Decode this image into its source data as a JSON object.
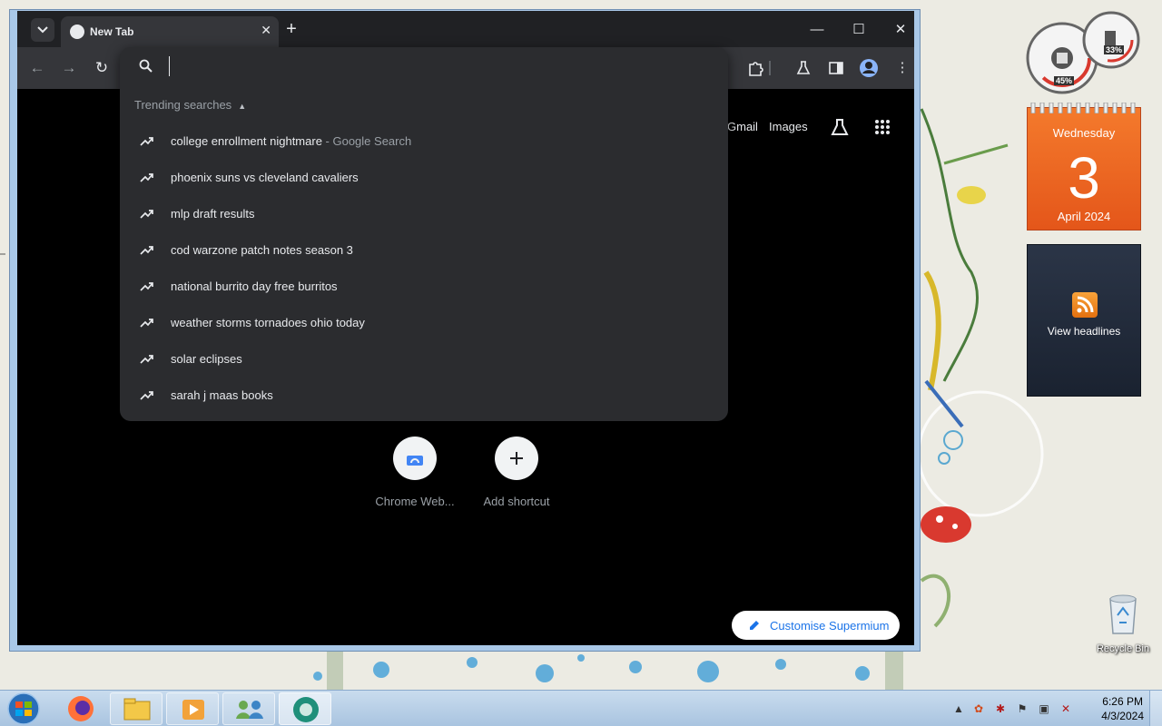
{
  "browser": {
    "tab": {
      "title": "New Tab",
      "close_icon": "close-icon"
    },
    "new_tab_icon": "plus-icon",
    "window_controls": [
      "minimize-icon",
      "maximize-icon",
      "close-icon"
    ],
    "toolbar_icons": [
      "back-icon",
      "forward-icon",
      "reload-icon",
      "extensions-icon",
      "labs-icon",
      "side-panel-icon",
      "profile-icon",
      "menu-icon"
    ]
  },
  "omnibox": {
    "input_value": "",
    "trending_header": "Trending searches",
    "suggestions": [
      {
        "text": "college enrollment nightmare",
        "sub": " - Google Search"
      },
      {
        "text": "phoenix suns vs cleveland cavaliers",
        "sub": ""
      },
      {
        "text": "mlp draft results",
        "sub": ""
      },
      {
        "text": "cod warzone patch notes season 3",
        "sub": ""
      },
      {
        "text": "national burrito day free burritos",
        "sub": ""
      },
      {
        "text": "weather storms tornadoes ohio today",
        "sub": ""
      },
      {
        "text": "solar eclipses",
        "sub": ""
      },
      {
        "text": "sarah j maas books",
        "sub": ""
      }
    ]
  },
  "ntp": {
    "header_links": {
      "gmail": "Gmail",
      "images": "Images"
    },
    "shortcuts": [
      {
        "label": "Chrome Web..."
      },
      {
        "label": "Add shortcut"
      }
    ],
    "customise_label": "Customise Supermium"
  },
  "gadgets": {
    "cpu_gauge": {
      "cpu_percent": "45%",
      "memory_percent": "33%"
    },
    "calendar": {
      "weekday": "Wednesday",
      "day": "3",
      "month_year": "April 2024"
    },
    "feed": {
      "label": "View headlines"
    }
  },
  "desktop": {
    "recycle_bin_label": "Recycle Bin"
  },
  "taskbar": {
    "clock_time": "6:26 PM",
    "clock_date": "4/3/2024"
  },
  "colors": {
    "browser_frame": "#202124",
    "toolbar": "#35363a",
    "omnibox_bg": "#2b2c2f",
    "accent_link": "#1a73e8",
    "calendar_orange": "#e4561a"
  }
}
